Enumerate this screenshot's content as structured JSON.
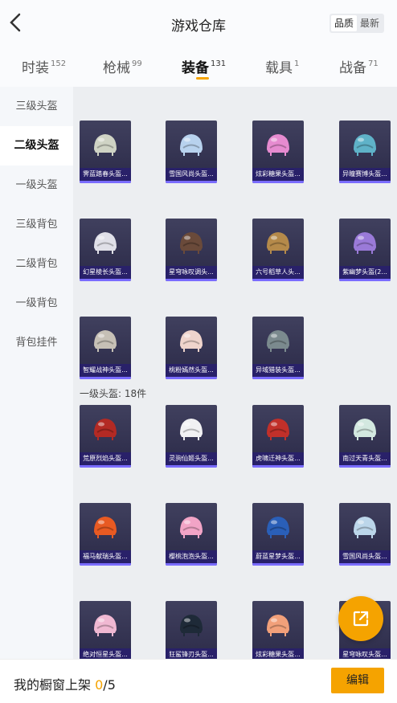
{
  "header": {
    "title": "游戏仓库",
    "sort": [
      "品质",
      "最新"
    ],
    "sort_active": 0
  },
  "tabs": [
    {
      "label": "时装",
      "count": "152"
    },
    {
      "label": "枪械",
      "count": "99"
    },
    {
      "label": "装备",
      "count": "131"
    },
    {
      "label": "载具",
      "count": "1"
    },
    {
      "label": "战备",
      "count": "71"
    }
  ],
  "tabs_active": 2,
  "sidebar": {
    "items": [
      "三级头盔",
      "二级头盔",
      "一级头盔",
      "三级背包",
      "二级背包",
      "一级背包",
      "背包挂件"
    ],
    "active": 1
  },
  "section_label": "一级头盔: 18件",
  "items": [
    {
      "name": "霁蓝踏春头盔...",
      "color": "#cfd3c4"
    },
    {
      "name": "雪国风尚头盔...",
      "color": "#b8d2ee"
    },
    {
      "name": "炫彩糖果头盔...",
      "color": "#e68bd0"
    },
    {
      "name": "异瞳赛博头盔...",
      "color": "#5fb2c8"
    },
    {
      "name": "幻星棱长头盔...",
      "color": "#e0e0e8"
    },
    {
      "name": "星穹咏叹调头...",
      "color": "#6a4a3a"
    },
    {
      "name": "六号稻草人头...",
      "color": "#b58a4a"
    },
    {
      "name": "紫幽梦头盔(2...",
      "color": "#9a7ad8"
    },
    {
      "name": "智耀战神头盔...",
      "color": "#c6c0b6"
    },
    {
      "name": "桃粉嫣然头盔...",
      "color": "#efd4cc"
    },
    {
      "name": "异域猎装头盔...",
      "color": "#7b8a8e"
    },
    {
      "name": "荒原烈焰头盔...",
      "color": "#b32a24"
    },
    {
      "name": "灵驹仙姬头盔...",
      "color": "#f1f1f3"
    },
    {
      "name": "虎啸迁神头盔...",
      "color": "#c1302a"
    },
    {
      "name": "南过天青头盔...",
      "color": "#d3e8e0"
    },
    {
      "name": "福马献瑞头盔...",
      "color": "#e85a22"
    },
    {
      "name": "樱桃泡泡头盔...",
      "color": "#f2a4c6"
    },
    {
      "name": "蔚蓝星梦头盔...",
      "color": "#2a5fb8"
    },
    {
      "name": "雪国风尚头盔...",
      "color": "#bcd6ea"
    },
    {
      "name": "绝对恒星头盔...",
      "color": "#f0b8d2"
    },
    {
      "name": "狂鲨锋刃头盔...",
      "color": "#1e2a38"
    },
    {
      "name": "炫彩糖果头盔...",
      "color": "#f2a07a"
    },
    {
      "name": "星穹咏叹头盔...",
      "color": "#9fb7d8"
    }
  ],
  "footer": {
    "label": "我的橱窗上架",
    "count": "0",
    "total": "/5",
    "edit": "编辑"
  },
  "icons": {
    "back": "chevron-left-icon",
    "share": "share-external-icon"
  },
  "accent": "#f5a300"
}
